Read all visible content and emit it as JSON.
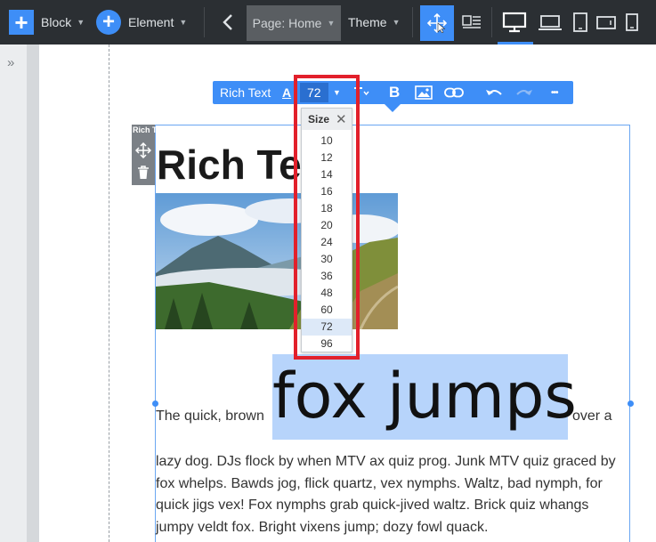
{
  "toolbar": {
    "block_label": "Block",
    "element_label": "Element",
    "page_label": "Page: Home",
    "theme_label": "Theme",
    "caret": "▼",
    "back_icon": "chevron-left-icon",
    "devices": [
      "desktop-icon",
      "laptop-icon",
      "tablet-icon",
      "tablet-landscape-icon",
      "mobile-icon"
    ]
  },
  "sidebar": {
    "expand_glyph": "»"
  },
  "rich_text_toolbar": {
    "label": "Rich Text",
    "font_color_glyph": "A",
    "font_size_value": "72",
    "bold_glyph": "B",
    "more_glyph": "•••"
  },
  "size_dropdown": {
    "title": "Size",
    "close_glyph": "✕",
    "options": [
      "10",
      "12",
      "14",
      "16",
      "18",
      "20",
      "24",
      "30",
      "36",
      "48",
      "60",
      "72",
      "96"
    ],
    "selected": "72"
  },
  "element_tools": {
    "label": "Rich T"
  },
  "content": {
    "heading": "Rich Tex",
    "para_start": "The quick, brown",
    "big_text": "fox jumps",
    "para_end": "over a",
    "lines": [
      "lazy dog. DJs flock by when MTV ax quiz prog. Junk MTV quiz graced by",
      "fox whelps. Bawds jog, flick quartz, vex nymphs. Waltz, bad nymph, for",
      "quick jigs vex! Fox nymphs grab quick-jived waltz. Brick quiz whangs",
      "jumpy veldt fox. Bright vixens jump; dozy fowl quack."
    ]
  },
  "colors": {
    "accent": "#3e8ef7",
    "highlight": "#e2202b",
    "selection": "#b7d4fb",
    "toolbar_bg": "#2b2f33"
  }
}
